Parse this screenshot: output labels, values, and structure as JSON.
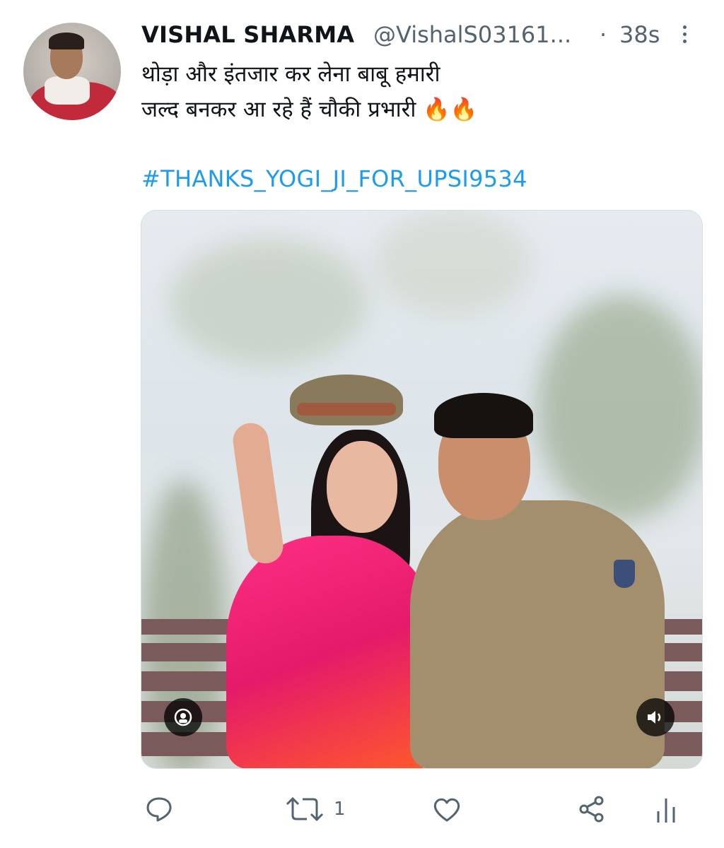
{
  "tweet": {
    "author_name": "VISHAL SHARMA",
    "author_handle": "@VishalS03161...",
    "separator": "·",
    "timestamp": "38s",
    "text_line1": "थोड़ा और इंतजार कर लेना बाबू हमारी",
    "text_line2": "जल्द बनकर आ रहे हैं चौकी प्रभारी 🔥🔥",
    "hashtag": "#THANKS_YOGI_JI_FOR_UPSI9534"
  },
  "actions": {
    "retweet_count": "1"
  },
  "colors": {
    "link": "#1d9bf0",
    "secondary_text": "#536471",
    "primary_text": "#0f1419"
  },
  "icons": {
    "reply": "reply-icon",
    "retweet": "retweet-icon",
    "like": "heart-icon",
    "share": "share-icon",
    "analytics": "analytics-icon",
    "more": "more-vertical-icon",
    "media_left": "user-tag-icon",
    "media_right": "volume-icon"
  }
}
